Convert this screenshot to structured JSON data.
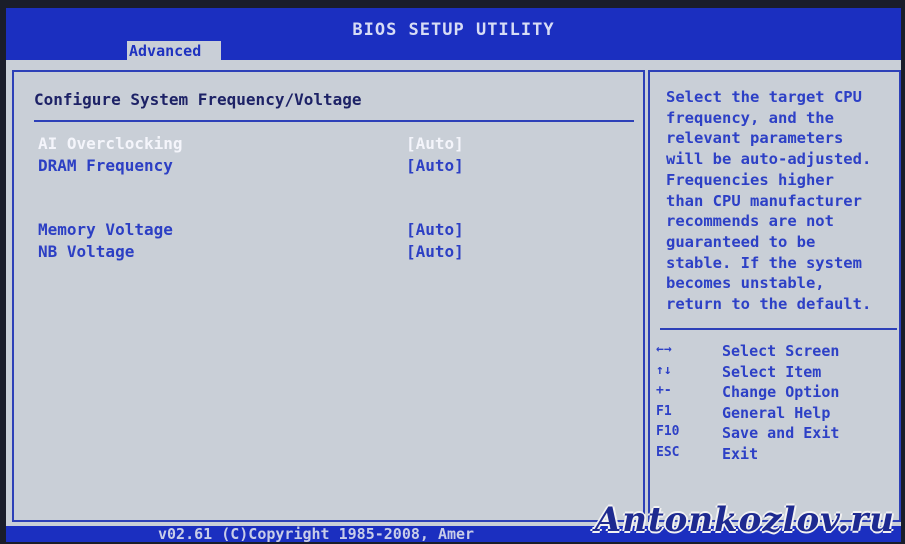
{
  "header": {
    "title": "BIOS SETUP UTILITY",
    "active_tab": "Advanced"
  },
  "main": {
    "section_title": "Configure System Frequency/Voltage",
    "items": [
      {
        "label": "AI Overclocking",
        "value": "[Auto]",
        "selected": true
      },
      {
        "label": "DRAM Frequency",
        "value": "[Auto]",
        "selected": false
      },
      {
        "label": "Memory Voltage",
        "value": "[Auto]",
        "selected": false
      },
      {
        "label": "NB Voltage",
        "value": "[Auto]",
        "selected": false
      }
    ]
  },
  "help": {
    "text": "Select the target CPU\nfrequency, and the\nrelevant parameters\nwill be auto-adjusted.\nFrequencies higher\nthan CPU manufacturer\nrecommends are not\nguaranteed to be\nstable. If the system\nbecomes unstable,\nreturn to the default.",
    "keys": [
      {
        "key": "←→",
        "desc": "Select Screen",
        "icon": "left-right-arrows-icon"
      },
      {
        "key": "↑↓",
        "desc": "Select Item",
        "icon": "up-down-arrows-icon"
      },
      {
        "key": "+-",
        "desc": "Change Option",
        "icon": "plus-minus-icon"
      },
      {
        "key": "F1",
        "desc": "General Help"
      },
      {
        "key": "F10",
        "desc": "Save and Exit"
      },
      {
        "key": "ESC",
        "desc": "Exit"
      }
    ]
  },
  "footer": {
    "text": "v02.61 (C)Copyright 1985-2008, Amer",
    "watermark": "Antonkozlov.ru"
  },
  "colors": {
    "header_blue": "#1b2fc0",
    "screen_bg": "#c9cfd7",
    "item_blue": "#2c3fc4",
    "selected_white": "#f4f5fb"
  }
}
